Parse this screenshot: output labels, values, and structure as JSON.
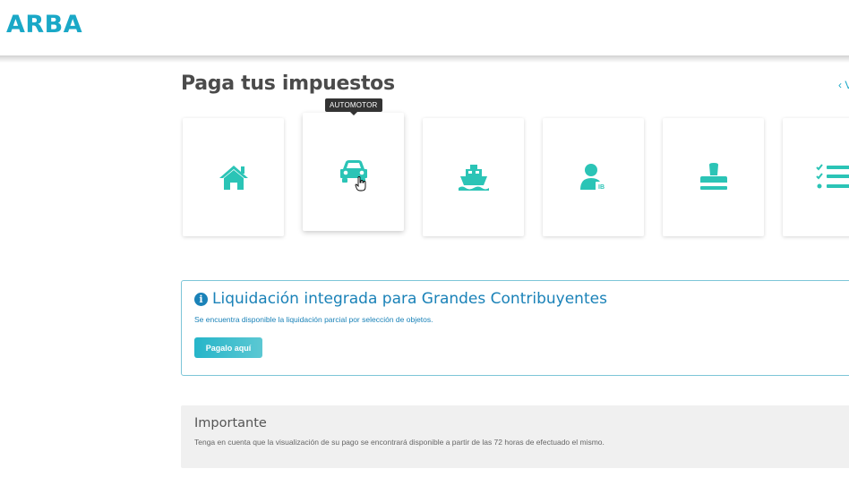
{
  "header": {
    "logo": "ARBA"
  },
  "page": {
    "title": "Paga tus impuestos",
    "back_link": "‹ V"
  },
  "tiles": [
    {
      "name": "inmobiliario",
      "icon": "house-icon"
    },
    {
      "name": "automotor",
      "icon": "car-icon",
      "tooltip": "AUTOMOTOR",
      "active": true
    },
    {
      "name": "embarcaciones",
      "icon": "ship-icon"
    },
    {
      "name": "ingresos-brutos",
      "icon": "person-ib-icon",
      "badge": "IB"
    },
    {
      "name": "sellos",
      "icon": "stamp-icon"
    },
    {
      "name": "planes",
      "icon": "checklist-icon"
    }
  ],
  "tooltip": {
    "text": "AUTOMOTOR"
  },
  "info": {
    "icon": "info-icon",
    "title": "Liquidación integrada para Grandes Contribuyentes",
    "text": "Se encuentra disponible la liquidación parcial por selección de objetos.",
    "button": "Pagalo aquí"
  },
  "note": {
    "title": "Importante",
    "text": "Tenga en cuenta que la visualización de su pago se encontrará disponible a partir de las 72 horas de efectuado el mismo."
  },
  "colors": {
    "brand": "#1aa8c7",
    "tile_icon": "#2bc4b6",
    "info_blue": "#1a82b8"
  }
}
